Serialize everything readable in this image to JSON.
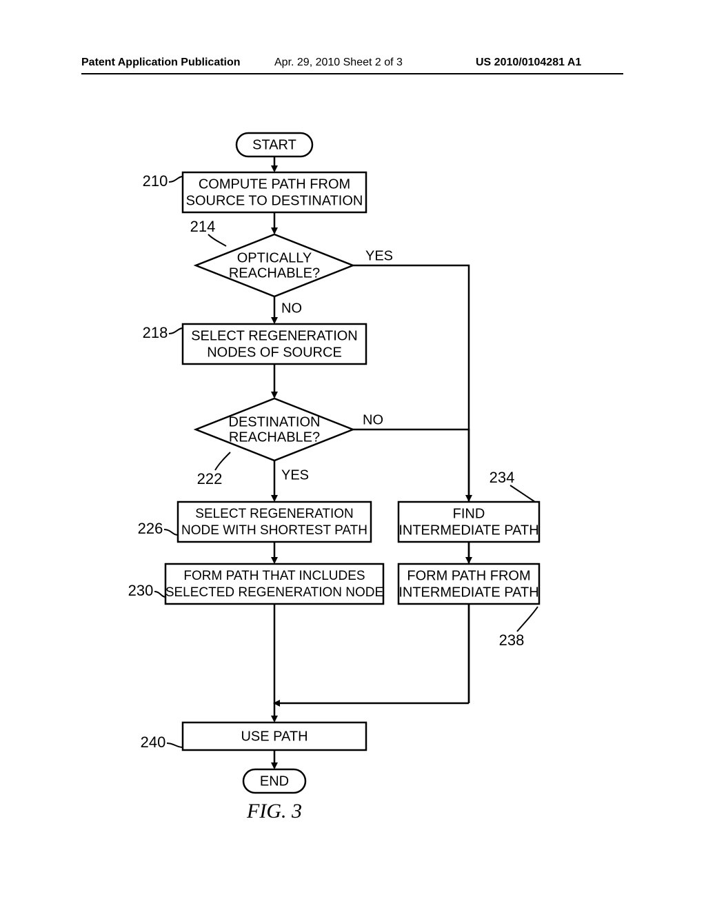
{
  "header": {
    "left": "Patent Application Publication",
    "mid": "Apr. 29, 2010  Sheet 2 of 3",
    "right": "US 2010/0104281 A1"
  },
  "chart_data": {
    "type": "flowchart",
    "title": "FIG. 3",
    "nodes": [
      {
        "id": "start",
        "kind": "terminator",
        "label": "START"
      },
      {
        "id": "210",
        "kind": "process",
        "ref": "210",
        "label": "COMPUTE PATH FROM SOURCE TO DESTINATION"
      },
      {
        "id": "214",
        "kind": "decision",
        "ref": "214",
        "label": "OPTICALLY REACHABLE?"
      },
      {
        "id": "218",
        "kind": "process",
        "ref": "218",
        "label": "SELECT REGENERATION NODES OF SOURCE"
      },
      {
        "id": "222",
        "kind": "decision",
        "ref": "222",
        "label": "DESTINATION REACHABLE?"
      },
      {
        "id": "226",
        "kind": "process",
        "ref": "226",
        "label": "SELECT REGENERATION NODE WITH SHORTEST PATH"
      },
      {
        "id": "230",
        "kind": "process",
        "ref": "230",
        "label": "FORM PATH THAT INCLUDES SELECTED REGENERATION NODE"
      },
      {
        "id": "234",
        "kind": "process",
        "ref": "234",
        "label": "FIND INTERMEDIATE PATH"
      },
      {
        "id": "238",
        "kind": "process",
        "ref": "238",
        "label": "FORM PATH FROM INTERMEDIATE PATH"
      },
      {
        "id": "240",
        "kind": "process",
        "ref": "240",
        "label": "USE PATH"
      },
      {
        "id": "end",
        "kind": "terminator",
        "label": "END"
      }
    ],
    "edges": [
      {
        "from": "start",
        "to": "210"
      },
      {
        "from": "210",
        "to": "214"
      },
      {
        "from": "214",
        "to": "218",
        "label": "NO"
      },
      {
        "from": "214",
        "to": "240",
        "label": "YES"
      },
      {
        "from": "218",
        "to": "222"
      },
      {
        "from": "222",
        "to": "226",
        "label": "YES"
      },
      {
        "from": "222",
        "to": "234",
        "label": "NO"
      },
      {
        "from": "226",
        "to": "230"
      },
      {
        "from": "234",
        "to": "238"
      },
      {
        "from": "230",
        "to": "240"
      },
      {
        "from": "238",
        "to": "240"
      },
      {
        "from": "240",
        "to": "end"
      }
    ]
  },
  "labels": {
    "start": "START",
    "end": "END",
    "fig": "FIG. 3",
    "yes": "YES",
    "no": "NO",
    "n210_l1": "COMPUTE PATH FROM",
    "n210_l2": "SOURCE TO DESTINATION",
    "n214_l1": "OPTICALLY",
    "n214_l2": "REACHABLE?",
    "n218_l1": "SELECT REGENERATION",
    "n218_l2": "NODES OF SOURCE",
    "n222_l1": "DESTINATION",
    "n222_l2": "REACHABLE?",
    "n226_l1": "SELECT REGENERATION",
    "n226_l2": "NODE WITH SHORTEST PATH",
    "n230_l1": "FORM PATH THAT INCLUDES",
    "n230_l2": "SELECTED REGENERATION NODE",
    "n234_l1": "FIND",
    "n234_l2": "INTERMEDIATE PATH",
    "n238_l1": "FORM PATH FROM",
    "n238_l2": "INTERMEDIATE PATH",
    "n240": "USE PATH"
  },
  "refs": {
    "r210": "210",
    "r214": "214",
    "r218": "218",
    "r222": "222",
    "r226": "226",
    "r230": "230",
    "r234": "234",
    "r238": "238",
    "r240": "240"
  }
}
